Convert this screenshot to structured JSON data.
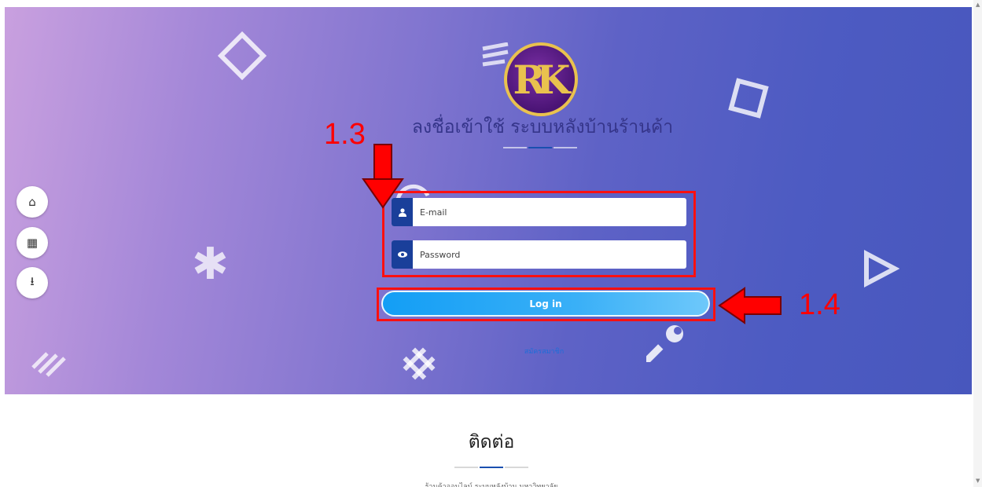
{
  "header": {
    "logo_text": "RK",
    "title": "ลงชื่อเข้าใช้ ระบบหลังบ้านร้านค้า"
  },
  "form": {
    "email_placeholder": "E-mail",
    "password_placeholder": "Password",
    "login_label": "Log in",
    "register_label": "สมัครสมาชิก"
  },
  "side_buttons": [
    {
      "icon": "home-icon",
      "glyph": "⌂"
    },
    {
      "icon": "store-icon",
      "glyph": "▦"
    },
    {
      "icon": "download-icon",
      "glyph": "⭳"
    }
  ],
  "icons": {
    "user": "user-icon",
    "eye": "eye-icon"
  },
  "annotations": {
    "step_credentials": "1.3",
    "step_login": "1.4"
  },
  "contact": {
    "title": "ติดต่อ",
    "address": "ร้านค้าออนไลน์ ระบบหลังบ้าน มหาวิทยาลัย"
  },
  "colors": {
    "accent": "#139ef5",
    "annotation": "#ff0000",
    "icon_bg": "#1a3f9a",
    "title": "#35358a"
  }
}
